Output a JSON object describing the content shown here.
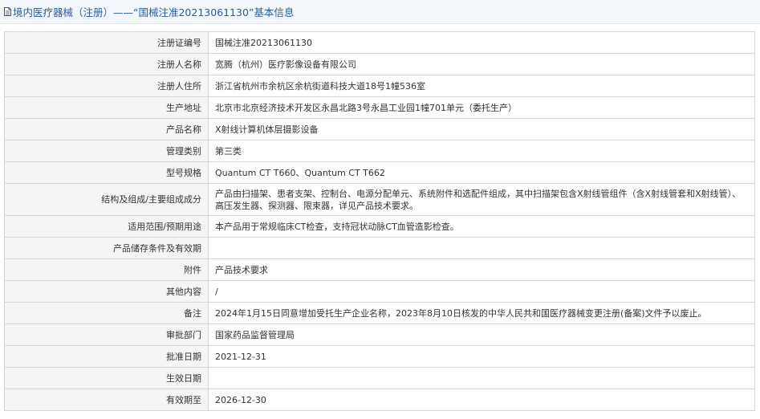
{
  "header": {
    "title": "境内医疗器械（注册）——“国械注准20213061130”基本信息",
    "icon": "document-icon"
  },
  "rows": [
    {
      "label": "注册证编号",
      "value": "国械注准20213061130"
    },
    {
      "label": "注册人名称",
      "value": "宽腾（杭州）医疗影像设备有限公司"
    },
    {
      "label": "注册人住所",
      "value": "浙江省杭州市余杭区余杭街道科技大道18号1幢536室"
    },
    {
      "label": "生产地址",
      "value": "北京市北京经济技术开发区永昌北路3号永昌工业园1幢701单元（委托生产）"
    },
    {
      "label": "产品名称",
      "value": "X射线计算机体层摄影设备"
    },
    {
      "label": "管理类别",
      "value": "第三类"
    },
    {
      "label": "型号规格",
      "value": "Quantum CT T660、Quantum CT T662"
    },
    {
      "label": "结构及组成/主要组成成分",
      "value": "产品由扫描架、患者支架、控制台、电源分配单元、系统附件和选配件组成，其中扫描架包含X射线管组件（含X射线管套和X射线管）、高压发生器、探测器、限束器，详见产品技术要求。"
    },
    {
      "label": "适用范围/预期用途",
      "value": "本产品用于常规临床CT检查，支持冠状动脉CT血管造影检查。"
    },
    {
      "label": "产品储存条件及有效期",
      "value": ""
    },
    {
      "label": "附件",
      "value": "产品技术要求"
    },
    {
      "label": "其他内容",
      "value": "/"
    },
    {
      "label": "备注",
      "value": "2024年1月15日同意增加受托生产企业名称，2023年8月10日核发的中华人民共和国医疗器械变更注册(备案)文件予以废止。"
    },
    {
      "label": "审批部门",
      "value": "国家药品监督管理局"
    },
    {
      "label": "批准日期",
      "value": "2021-12-31"
    },
    {
      "label": "生效日期",
      "value": ""
    },
    {
      "label": "有效期至",
      "value": "2026-12-30"
    }
  ]
}
